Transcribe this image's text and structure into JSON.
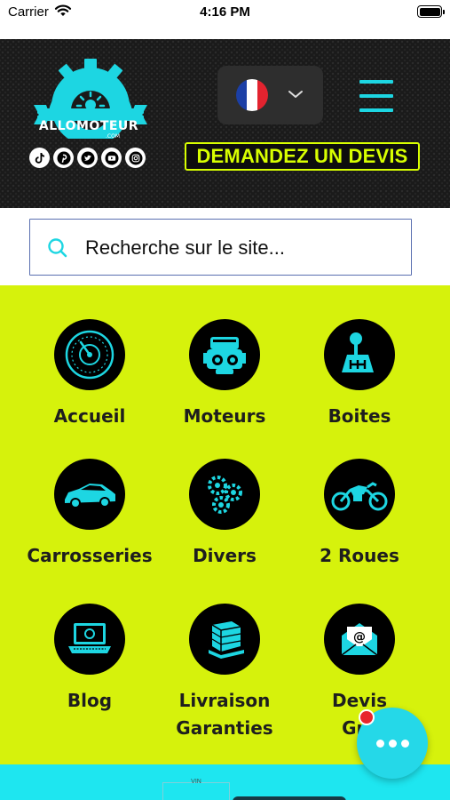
{
  "status_bar": {
    "carrier": "Carrier",
    "time": "4:16 PM"
  },
  "header": {
    "logo_text": "ALLOMOTEUR",
    "logo_sub": ".COM",
    "social_icons": [
      "tiktok-icon",
      "pinterest-icon",
      "twitter-icon",
      "youtube-icon",
      "instagram-icon"
    ],
    "language_flag": "france-flag-icon",
    "devis_banner": "DEMANDEZ UN DEVIS"
  },
  "search": {
    "placeholder": "Recherche sur le site..."
  },
  "categories": [
    {
      "label": "Accueil",
      "icon": "speedometer-icon"
    },
    {
      "label": "Moteurs",
      "icon": "engine-icon"
    },
    {
      "label": "Boites",
      "icon": "gearbox-icon"
    },
    {
      "label": "Carrosseries",
      "icon": "car-icon"
    },
    {
      "label": "Divers",
      "icon": "gears-icon"
    },
    {
      "label": "2 Roues",
      "icon": "motorcycle-icon"
    },
    {
      "label": "Blog",
      "icon": "laptop-icon"
    },
    {
      "label": "Livraison Garanties",
      "line1": "Livraison",
      "line2": "Garanties",
      "icon": "pallet-icon"
    },
    {
      "label": "Devis Gra",
      "line1": "Devis",
      "line2": "Gra",
      "icon": "email-icon"
    }
  ],
  "bottom": {
    "vin_label": "VIN"
  },
  "chat": {
    "icon": "more-dots-icon"
  },
  "colors": {
    "accent": "#1dd6e2",
    "lime": "#d6f20c",
    "header_bg": "#1a1a1a",
    "badge": "#e8252b"
  }
}
